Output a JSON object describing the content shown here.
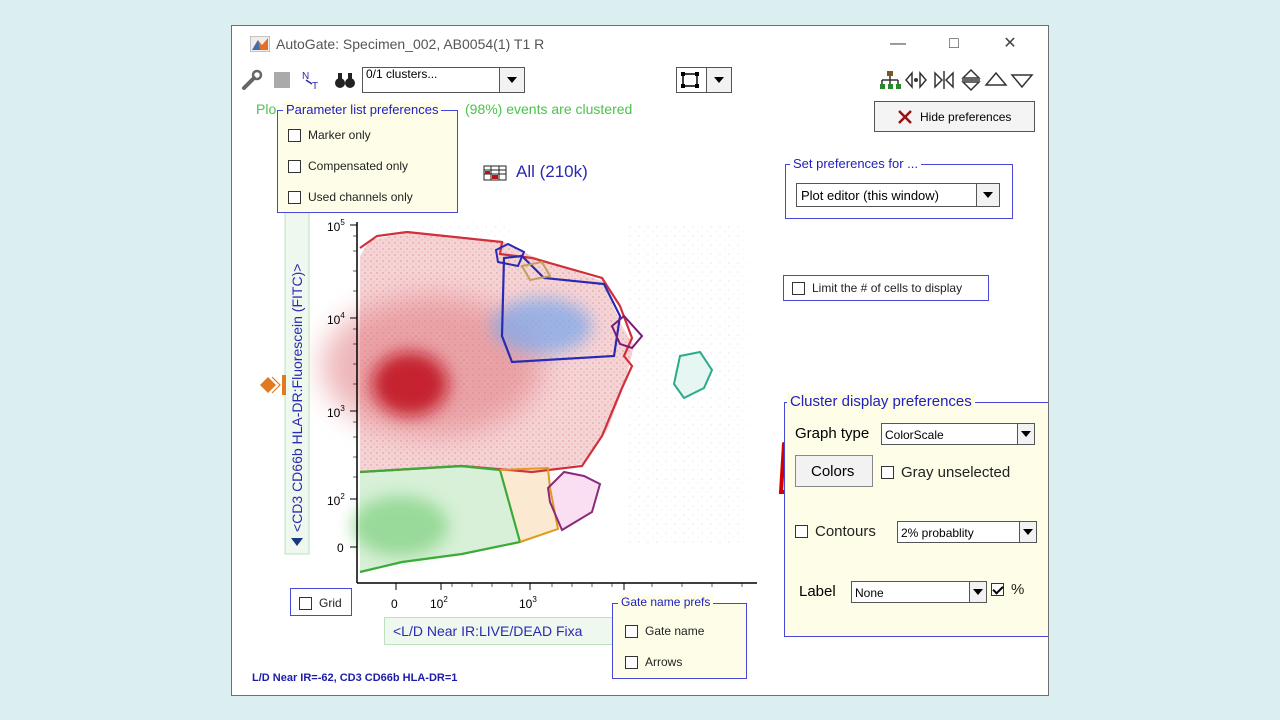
{
  "window": {
    "title": "AutoGate: Specimen_002, AB0054(1) T1 R",
    "controls": {
      "minimize": "—",
      "maximize": "□",
      "close": "✕"
    }
  },
  "toolbar": {
    "cluster_select_value": "0/1 clusters...",
    "icons": [
      "wrench-icon",
      "blank-icon",
      "pattern-icon",
      "binoculars-icon",
      "selection-icon",
      "hierarchy-icon",
      "left-right-icon",
      "split-icon",
      "up-down-icon",
      "up-icon",
      "down-icon"
    ]
  },
  "events_text": {
    "prefix": "Plo",
    "suffix": "(98%) events are clustered"
  },
  "parameter_prefs": {
    "title": "Parameter list preferences",
    "options": [
      {
        "label": "Marker only",
        "checked": false
      },
      {
        "label": "Compensated only",
        "checked": false
      },
      {
        "label": "Used channels only",
        "checked": false
      }
    ]
  },
  "all_label": "All (210k)",
  "hide_prefs_button": "Hide preferences",
  "set_prefs": {
    "title": "Set preferences for ...",
    "value": "Plot editor (this window)"
  },
  "limit_cells": {
    "label": "Limit the # of cells to display",
    "checked": false
  },
  "cluster_display": {
    "title": "Cluster display preferences",
    "graph_type_label": "Graph type",
    "graph_type_value": "ColorScale",
    "colors_button": "Colors",
    "gray_unselected": "Gray unselected",
    "contours_label": "Contours",
    "contours_value": "2% probablity",
    "label_label": "Label",
    "label_value": "None",
    "percent_label": "%",
    "percent_checked": true
  },
  "plot": {
    "y_axis_label": "<CD3 CD66b HLA-DR:Fluorescein (FITC)>",
    "x_axis_label": "<L/D Near IR:LIVE/DEAD Fixa",
    "y_ticks": [
      {
        "label": "10",
        "sup": "5"
      },
      {
        "label": "10",
        "sup": "4"
      },
      {
        "label": "10",
        "sup": "3"
      },
      {
        "label": "10",
        "sup": "2"
      },
      {
        "label": "0",
        "sup": ""
      }
    ],
    "x_ticks": [
      {
        "label": "0",
        "sup": ""
      },
      {
        "label": "10",
        "sup": "2"
      },
      {
        "label": "10",
        "sup": "3"
      }
    ],
    "grid_label": "Grid"
  },
  "gate_prefs": {
    "title": "Gate name prefs",
    "options": [
      {
        "label": "Gate name",
        "checked": false
      },
      {
        "label": "Arrows",
        "checked": false
      }
    ]
  },
  "status": {
    "line": "L/D Near IR=-62, CD3 CD66b HLA-DR=1"
  },
  "colors": {
    "red_gate": "#d0303a",
    "blue_gate": "#2a2ab0",
    "green_gate": "#3aaa3a",
    "teal_gate": "#2aaa8a",
    "orange_gate": "#e09a20",
    "annotation": "#d40000"
  }
}
